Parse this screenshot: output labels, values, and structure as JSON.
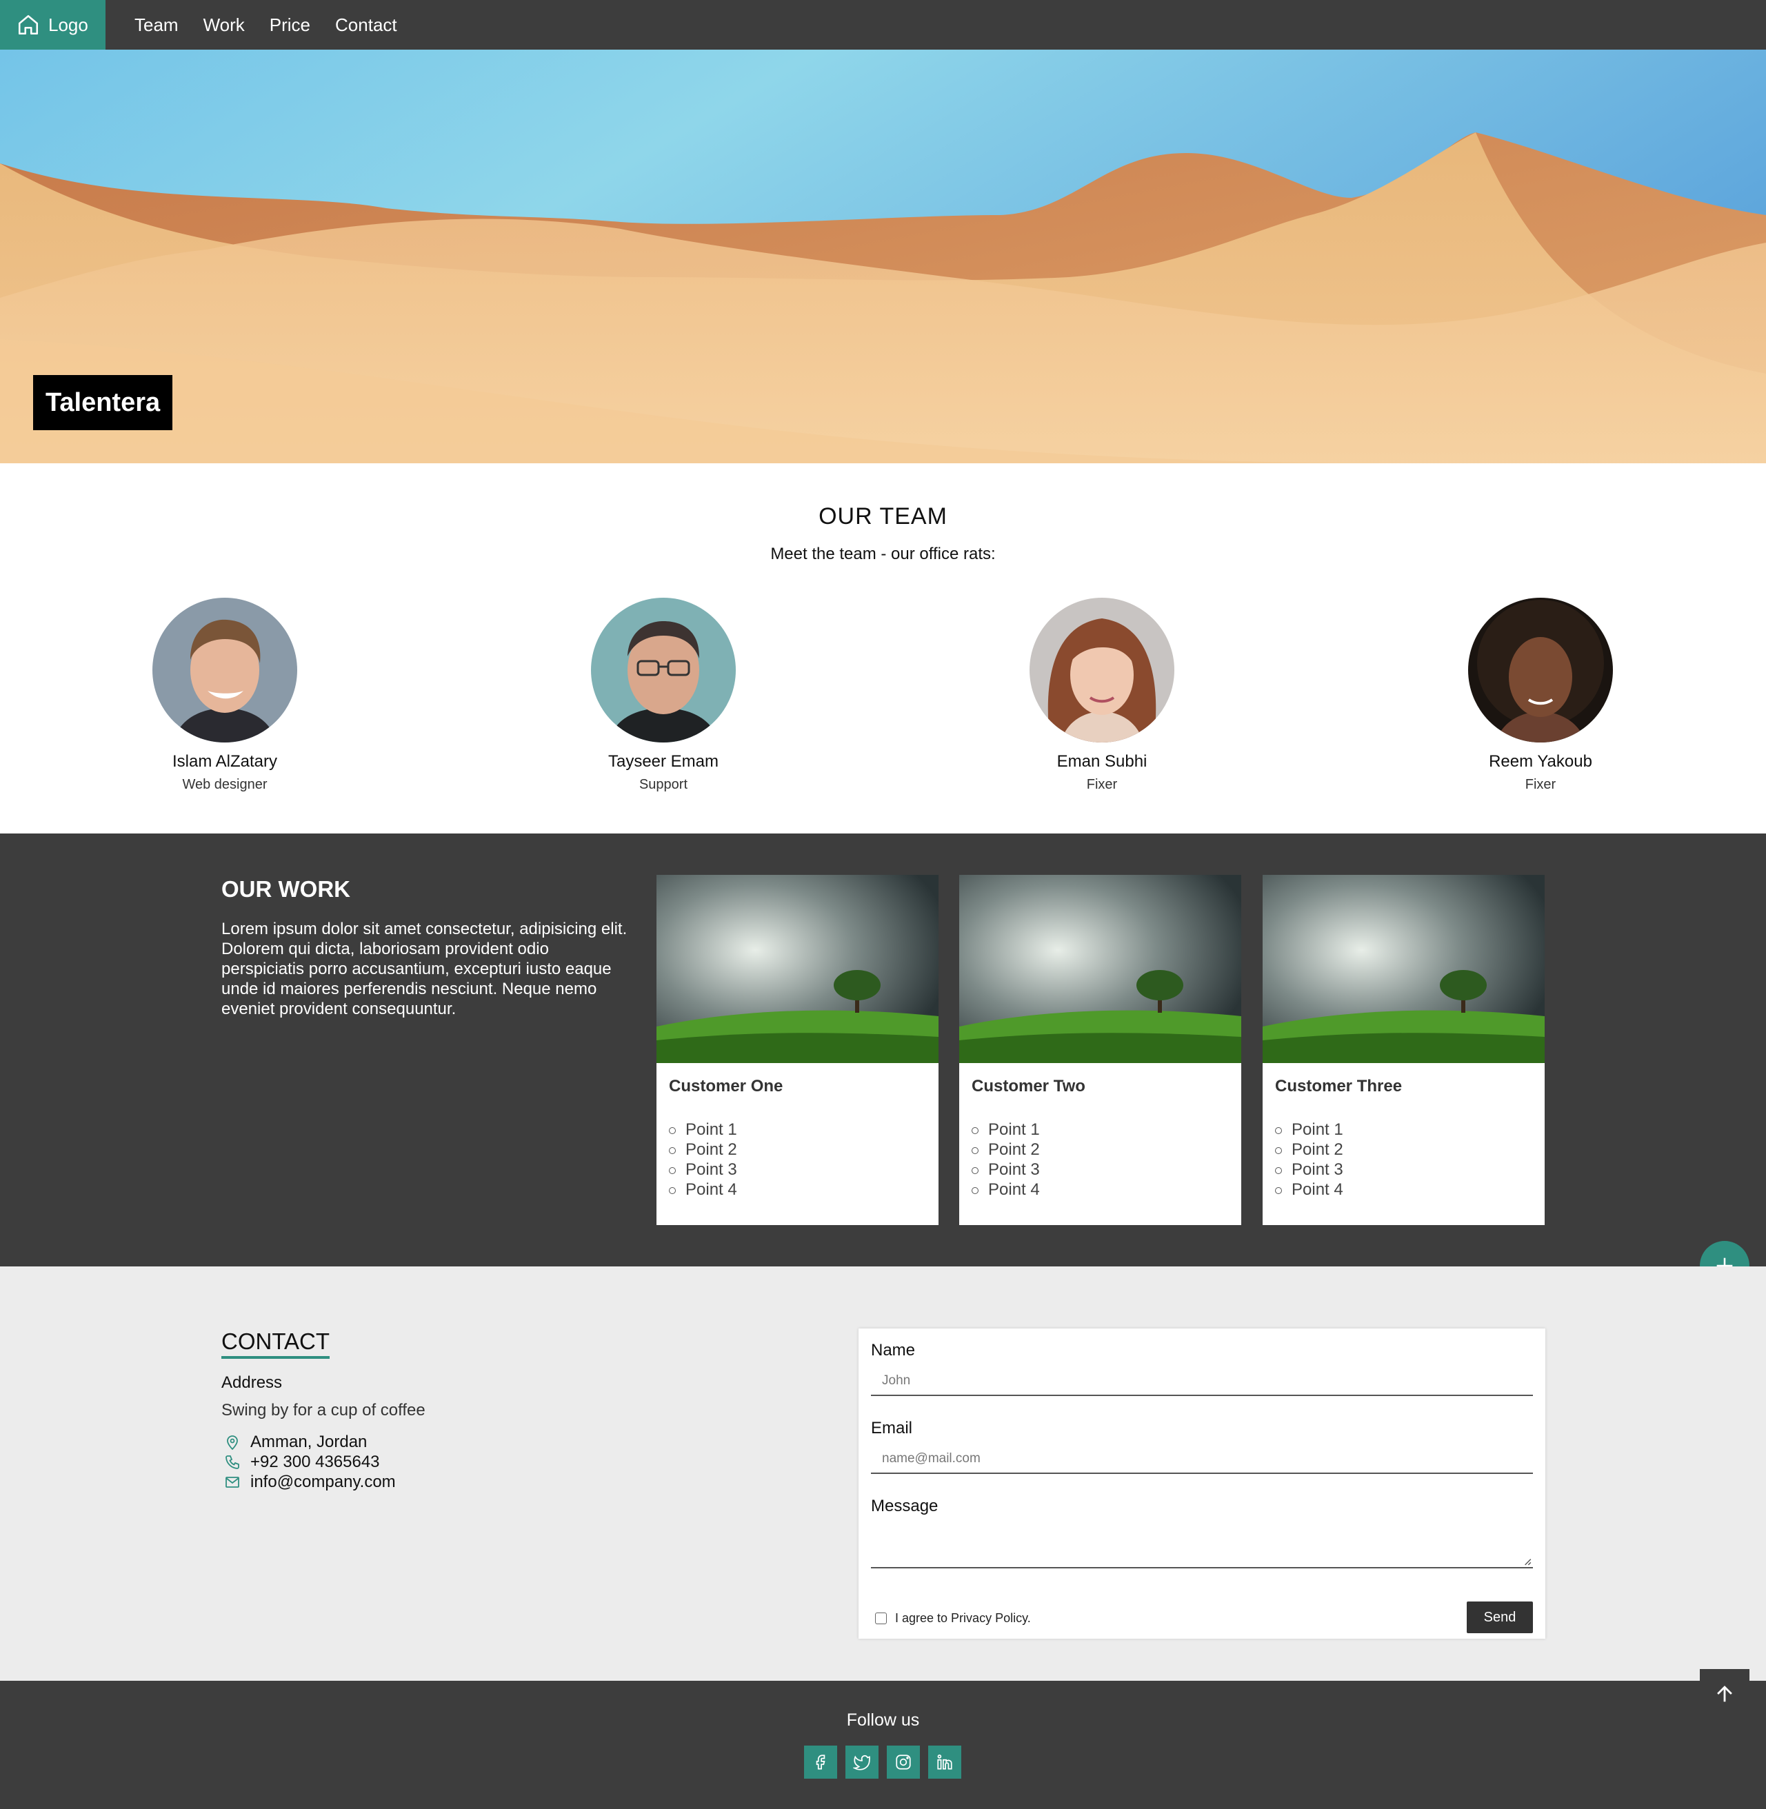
{
  "nav": {
    "logo_label": "Logo",
    "links": [
      "Team",
      "Work",
      "Price",
      "Contact"
    ]
  },
  "hero": {
    "brand": "Talentera"
  },
  "team": {
    "title": "OUR TEAM",
    "subtitle": "Meet the team - our office rats:",
    "members": [
      {
        "name": "Islam AlZatary",
        "role": "Web designer"
      },
      {
        "name": "Tayseer Emam",
        "role": "Support"
      },
      {
        "name": "Eman Subhi",
        "role": "Fixer"
      },
      {
        "name": "Reem Yakoub",
        "role": "Fixer"
      }
    ]
  },
  "work": {
    "title": "OUR WORK",
    "text": "Lorem ipsum dolor sit amet consectetur, adipisicing elit. Dolorem qui dicta, laboriosam provident odio perspiciatis porro accusantium, excepturi iusto eaque unde id maiores perferendis nesciunt. Neque nemo eveniet provident consequuntur.",
    "cards": [
      {
        "title": "Customer One",
        "points": [
          "Point 1",
          "Point 2",
          "Point 3",
          "Point 4"
        ]
      },
      {
        "title": "Customer Two",
        "points": [
          "Point 1",
          "Point 2",
          "Point 3",
          "Point 4"
        ]
      },
      {
        "title": "Customer Three",
        "points": [
          "Point 1",
          "Point 2",
          "Point 3",
          "Point 4"
        ]
      }
    ]
  },
  "contact": {
    "title": "CONTACT",
    "address_heading": "Address",
    "tagline": "Swing by for a cup of coffee",
    "location": "Amman, Jordan",
    "phone": "+92 300 4365643",
    "email": "info@company.com",
    "form": {
      "name_label": "Name",
      "name_placeholder": "John",
      "email_label": "Email",
      "email_placeholder": "name@mail.com",
      "message_label": "Message",
      "agree_label": "I agree to Privacy Policy.",
      "send_label": "Send"
    }
  },
  "footer": {
    "follow": "Follow us"
  },
  "colors": {
    "accent": "#2f8f80",
    "dark": "#3d3d3d",
    "light": "#ececec"
  },
  "icons": [
    "home-icon",
    "plus-icon",
    "location-icon",
    "phone-icon",
    "mail-icon",
    "arrow-up-icon",
    "facebook-icon",
    "twitter-icon",
    "instagram-icon",
    "linkedin-icon"
  ]
}
